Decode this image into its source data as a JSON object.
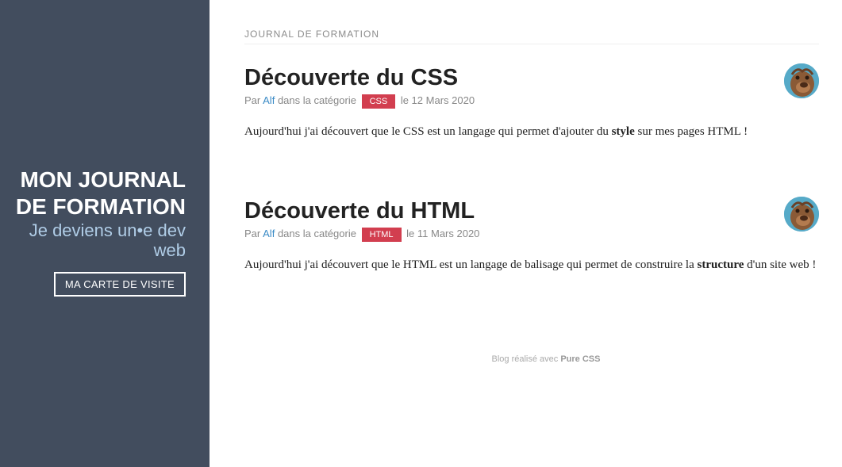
{
  "sidebar": {
    "title": "MON JOURNAL DE FORMATION",
    "tagline": "Je deviens un•e dev web",
    "card_button": "MA CARTE DE VISITE"
  },
  "main": {
    "section_title": "JOURNAL DE FORMATION",
    "posts": [
      {
        "title": "Découverte du CSS",
        "meta_by": "Par",
        "author": "Alf",
        "meta_category": "dans la catégorie",
        "tag": "CSS",
        "date": "le 12 Mars 2020",
        "desc_before": "Aujourd'hui j'ai découvert que le CSS est un langage qui permet d'ajouter du ",
        "desc_strong": "style",
        "desc_after": " sur mes pages HTML !"
      },
      {
        "title": "Découverte du HTML",
        "meta_by": "Par",
        "author": "Alf",
        "meta_category": "dans la catégorie",
        "tag": "HTML",
        "date": "le 11 Mars 2020",
        "desc_before": "Aujourd'hui j'ai découvert que le HTML est un langage de balisage qui permet de construire la ",
        "desc_strong": "structure",
        "desc_after": " d'un site web !"
      }
    ]
  },
  "footer": {
    "text": "Blog réalisé avec ",
    "link": "Pure CSS"
  },
  "colors": {
    "sidebar_bg": "#424d5e",
    "tagline": "#b0cde7",
    "tag_bg": "#d23e4f",
    "link": "#3b8bc6"
  }
}
